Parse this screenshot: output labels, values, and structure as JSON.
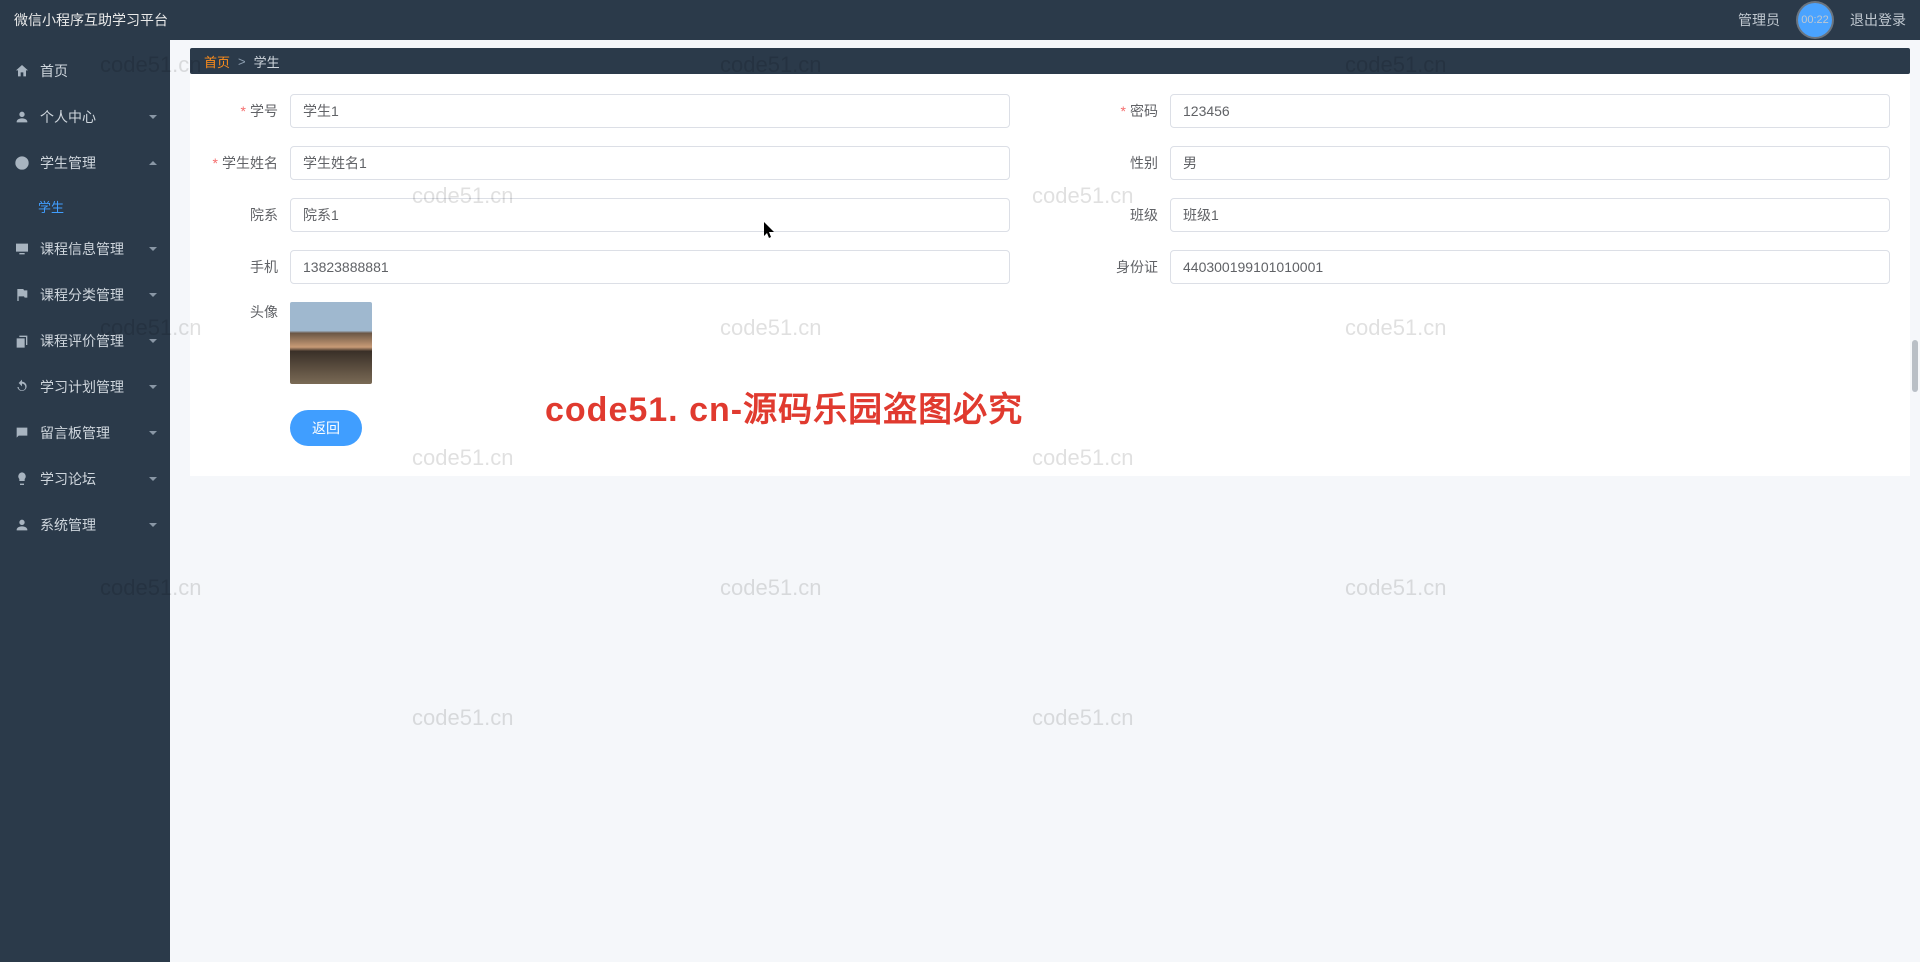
{
  "header": {
    "title": "微信小程序互助学习平台",
    "admin_label": "管理员",
    "badge_time": "00:22",
    "logout": "退出登录"
  },
  "sidebar": {
    "items": [
      {
        "label": "首页",
        "icon": "home",
        "expandable": false
      },
      {
        "label": "个人中心",
        "icon": "person",
        "expandable": true
      },
      {
        "label": "学生管理",
        "icon": "clock",
        "expandable": true,
        "expanded": true,
        "children": [
          {
            "label": "学生",
            "active": true
          }
        ]
      },
      {
        "label": "课程信息管理",
        "icon": "monitor",
        "expandable": true
      },
      {
        "label": "课程分类管理",
        "icon": "flag",
        "expandable": true
      },
      {
        "label": "课程评价管理",
        "icon": "copy",
        "expandable": true
      },
      {
        "label": "学习计划管理",
        "icon": "refresh",
        "expandable": true
      },
      {
        "label": "留言板管理",
        "icon": "chat",
        "expandable": true
      },
      {
        "label": "学习论坛",
        "icon": "bulb",
        "expandable": true
      },
      {
        "label": "系统管理",
        "icon": "person",
        "expandable": true
      }
    ]
  },
  "breadcrumb": {
    "home": "首页",
    "sep": ">",
    "current": "学生"
  },
  "form": {
    "fields": {
      "student_id": {
        "label": "学号",
        "value": "学生1",
        "required": true
      },
      "password": {
        "label": "密码",
        "value": "123456",
        "required": true
      },
      "name": {
        "label": "学生姓名",
        "value": "学生姓名1",
        "required": true
      },
      "gender": {
        "label": "性别",
        "value": "男",
        "required": false
      },
      "department": {
        "label": "院系",
        "value": "院系1",
        "required": false
      },
      "class": {
        "label": "班级",
        "value": "班级1",
        "required": false
      },
      "phone": {
        "label": "手机",
        "value": "13823888881",
        "required": false
      },
      "id_card": {
        "label": "身份证",
        "value": "440300199101010001",
        "required": false
      },
      "avatar": {
        "label": "头像"
      }
    },
    "back_button": "返回"
  },
  "watermarks": {
    "text": "code51.cn",
    "red_text": "code51. cn-源码乐园盗图必究"
  }
}
